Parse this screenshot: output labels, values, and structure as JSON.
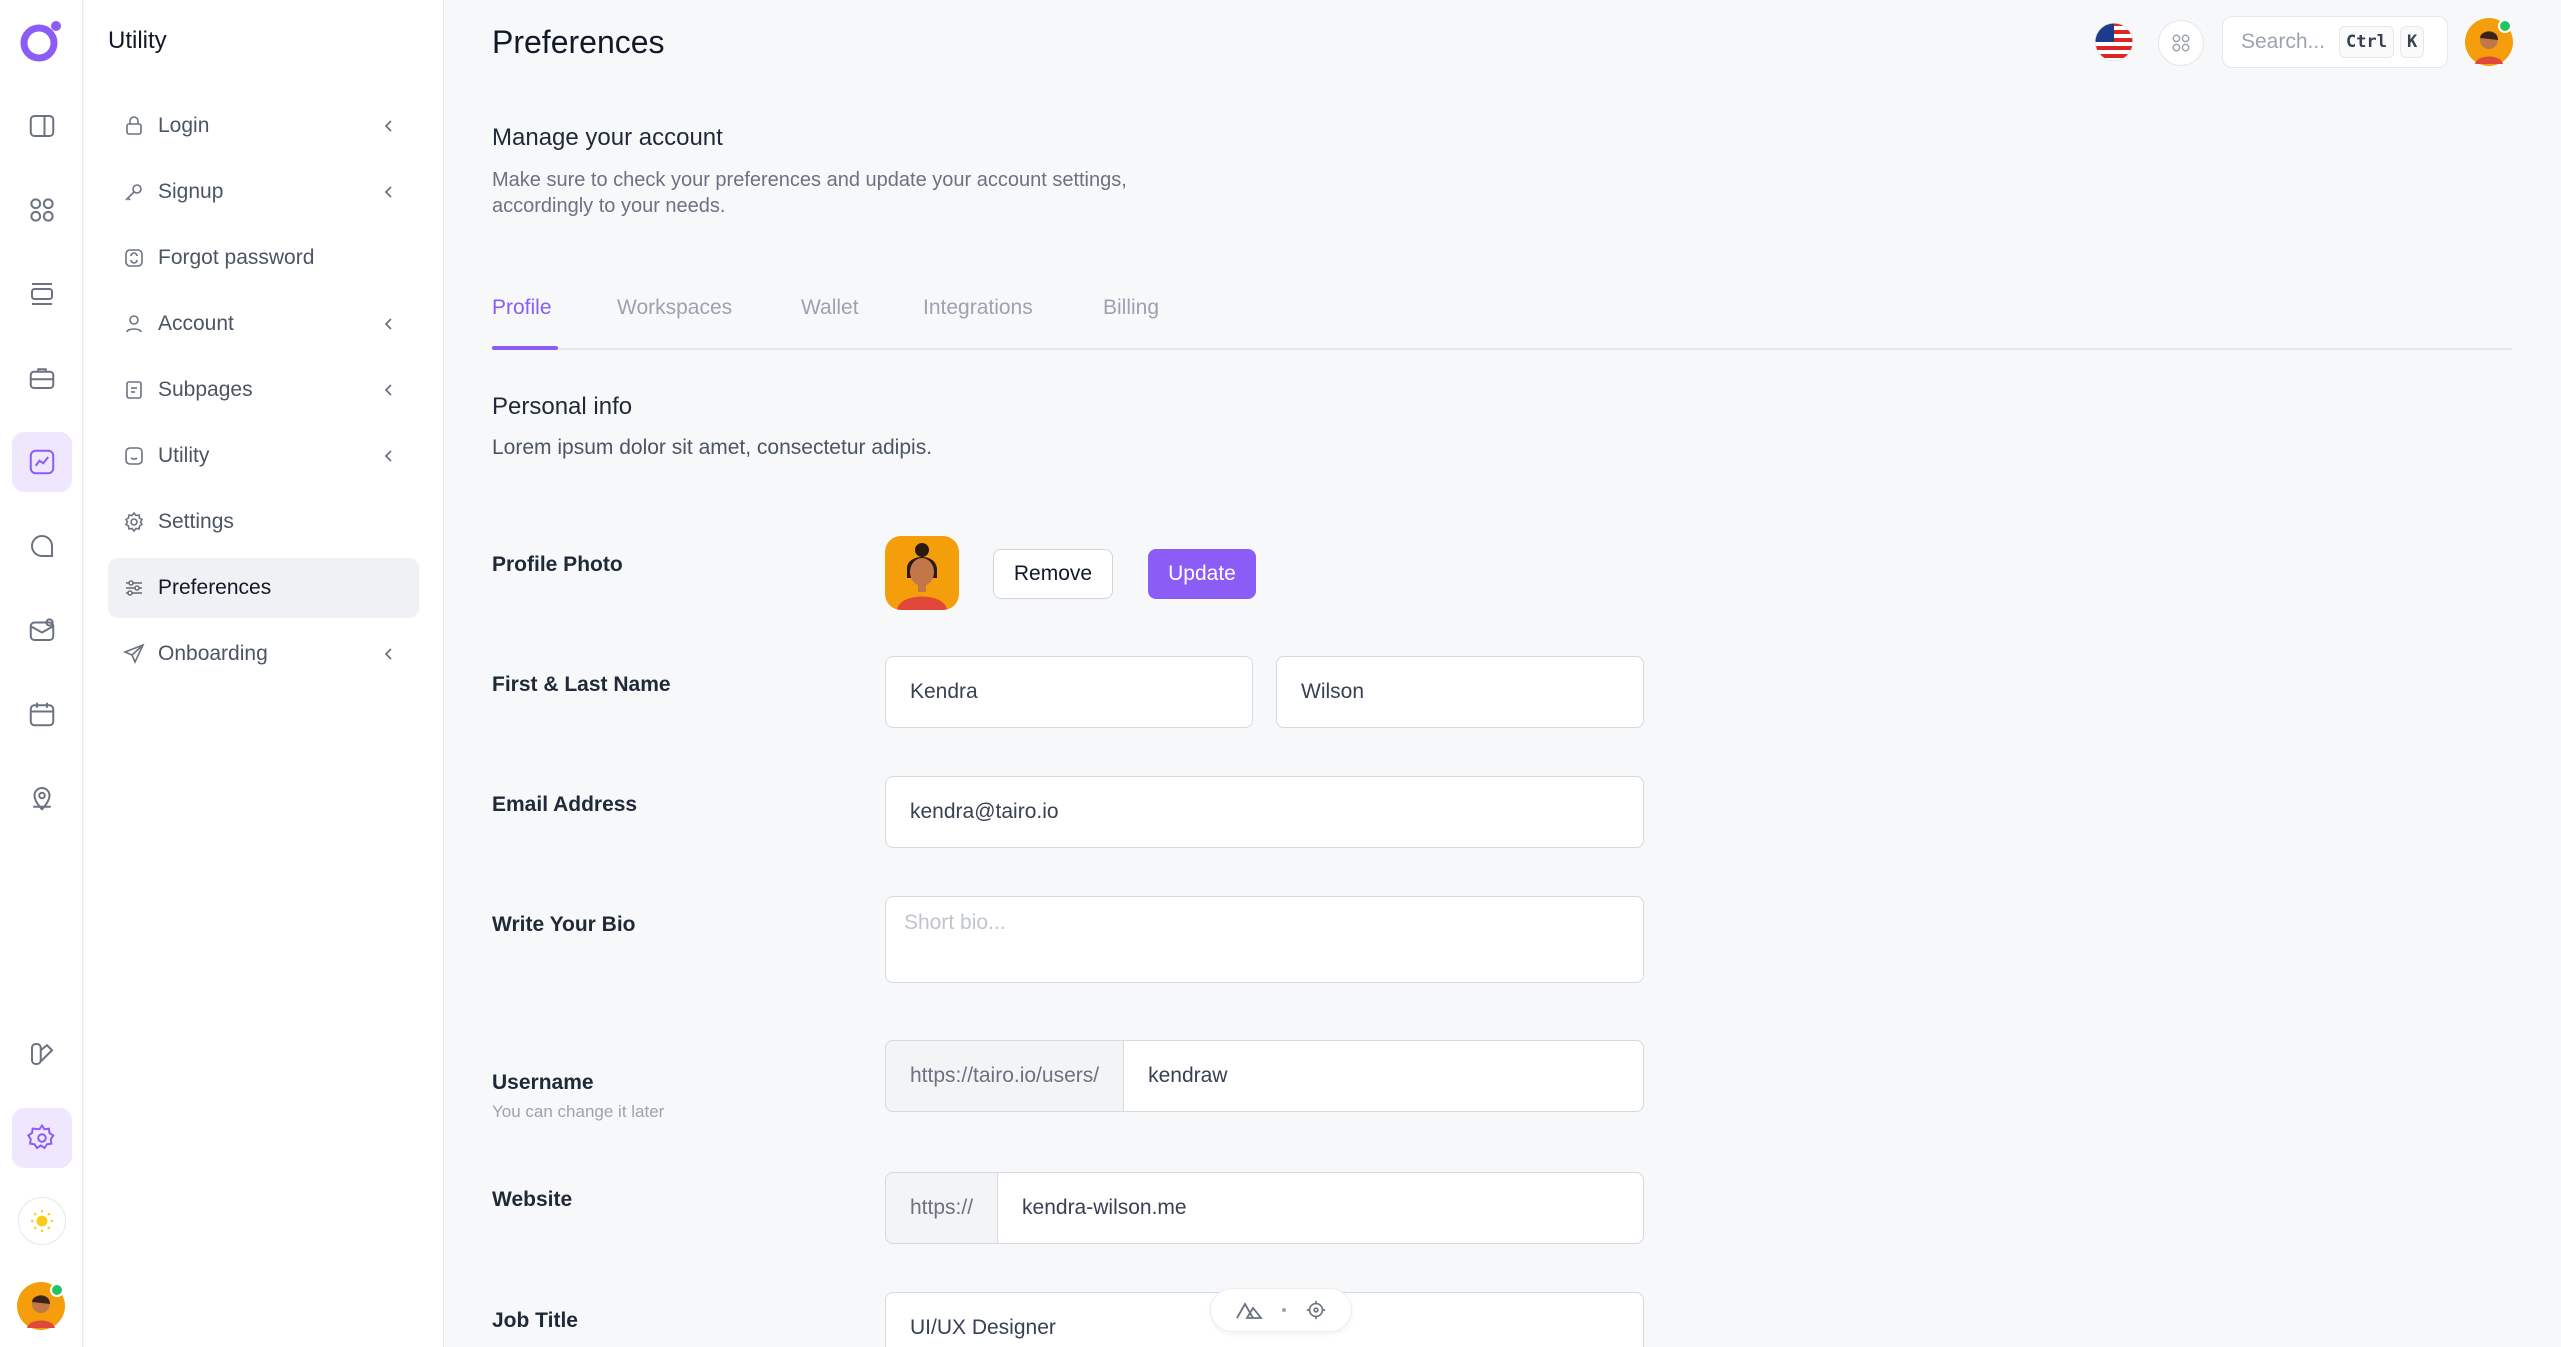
{
  "subnav": {
    "title": "Utility",
    "items": [
      {
        "label": "Login"
      },
      {
        "label": "Signup"
      },
      {
        "label": "Forgot password"
      },
      {
        "label": "Account"
      },
      {
        "label": "Subpages"
      },
      {
        "label": "Utility"
      },
      {
        "label": "Settings"
      },
      {
        "label": "Preferences"
      },
      {
        "label": "Onboarding"
      }
    ]
  },
  "header": {
    "title": "Preferences",
    "search_placeholder": "Search...",
    "kbd_ctrl": "Ctrl",
    "kbd_k": "K"
  },
  "intro": {
    "title": "Manage your account",
    "description": "Make sure to check your preferences and update your account settings, accordingly to your needs."
  },
  "tabs": [
    {
      "label": "Profile"
    },
    {
      "label": "Workspaces"
    },
    {
      "label": "Wallet"
    },
    {
      "label": "Integrations"
    },
    {
      "label": "Billing"
    }
  ],
  "personal": {
    "title": "Personal info",
    "description": "Lorem ipsum dolor sit amet, consectetur adipis."
  },
  "form": {
    "photo_label": "Profile Photo",
    "remove_label": "Remove",
    "update_label": "Update",
    "name_label": "First & Last Name",
    "first_name": "Kendra",
    "last_name": "Wilson",
    "email_label": "Email Address",
    "email": "kendra@tairo.io",
    "bio_label": "Write Your Bio",
    "bio_placeholder": "Short bio...",
    "username_label": "Username",
    "username_hint": "You can change it later",
    "username_prefix": "https://tairo.io/users/",
    "username": "kendraw",
    "website_label": "Website",
    "website_prefix": "https://",
    "website": "kendra-wilson.me",
    "job_label": "Job Title",
    "job": "UI/UX Designer"
  },
  "colors": {
    "accent": "#8b5cf6",
    "accent_soft": "#efe7fe",
    "background": "#f7f8fa"
  }
}
